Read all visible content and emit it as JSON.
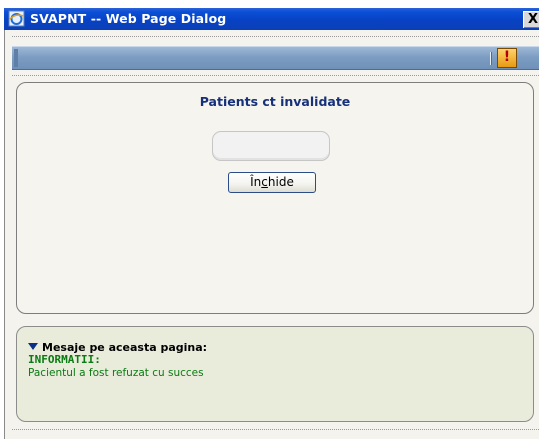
{
  "window": {
    "title": "SVAPNT -- Web Page Dialog",
    "close_glyph": "X",
    "icon": "ie-page-icon",
    "title_bar_color": "#0a4fd6"
  },
  "toolbar": {
    "alert_icon": "exclamation-icon",
    "alert_glyph": "!",
    "background_color": "#7d9dc2"
  },
  "main": {
    "title": "Patients ct invalidate",
    "value": "",
    "close_button": {
      "label_before": "În",
      "label_accel": "c",
      "label_after": "hide"
    }
  },
  "messages": {
    "toggle_icon": "triangle-down-icon",
    "header": "Mesaje pe aceasta pagina:",
    "info_heading": "INFORMATII:",
    "info_text": "Pacientul a fost refuzat cu succes",
    "info_color": "#0a7a12"
  }
}
